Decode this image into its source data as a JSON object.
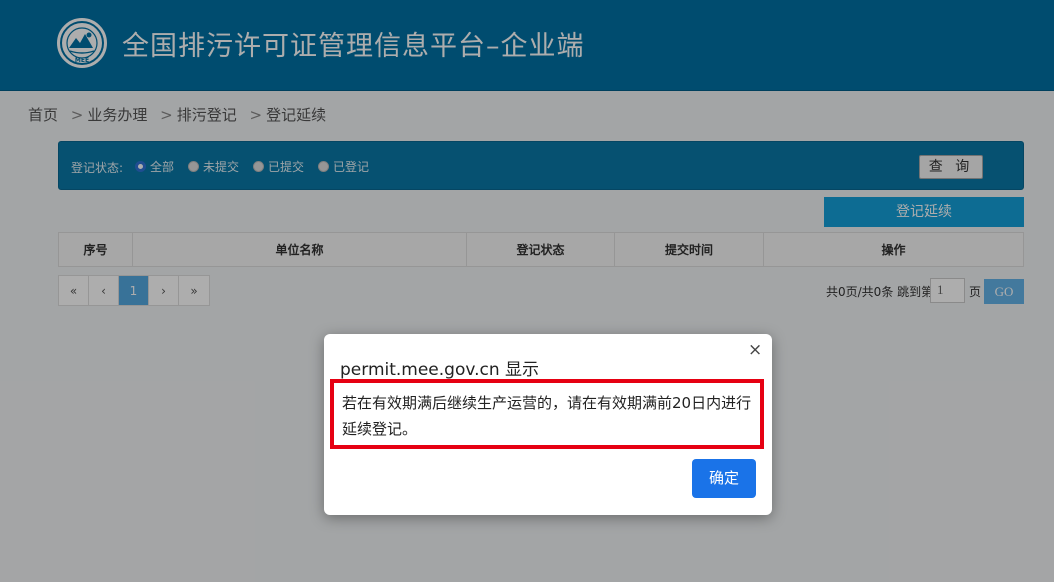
{
  "header": {
    "logo_text": "MEE",
    "title": "全国排污许可证管理信息平台–企业端"
  },
  "breadcrumb": {
    "items": [
      "首页",
      "业务办理",
      "排污登记",
      "登记延续"
    ],
    "separator": ">"
  },
  "filter": {
    "label": "登记状态:",
    "options": [
      {
        "label": "全部",
        "checked": true
      },
      {
        "label": "未提交",
        "checked": false
      },
      {
        "label": "已提交",
        "checked": false
      },
      {
        "label": "已登记",
        "checked": false
      }
    ],
    "query_label": "查 询"
  },
  "actions": {
    "renew_label": "登记延续"
  },
  "table": {
    "columns": [
      "序号",
      "单位名称",
      "登记状态",
      "提交时间",
      "操作"
    ]
  },
  "pagination": {
    "first": "«",
    "prev": "‹",
    "current": "1",
    "next": "›",
    "last": "»",
    "info": "共0页/共0条 跳到第",
    "input_value": "1",
    "suffix": "页",
    "go_label": "GO"
  },
  "dialog": {
    "title": "permit.mee.gov.cn 显示",
    "close": "×",
    "message": "若在有效期满后继续生产运营的，请在有效期满前20日内进行延续登记。",
    "ok_label": "确定"
  },
  "colors": {
    "header_bg": "#0071a4",
    "filter_bg": "#0a78a7",
    "renew_bg": "#14a0d9",
    "ok_bg": "#1a73e8",
    "highlight": "#e60012"
  }
}
